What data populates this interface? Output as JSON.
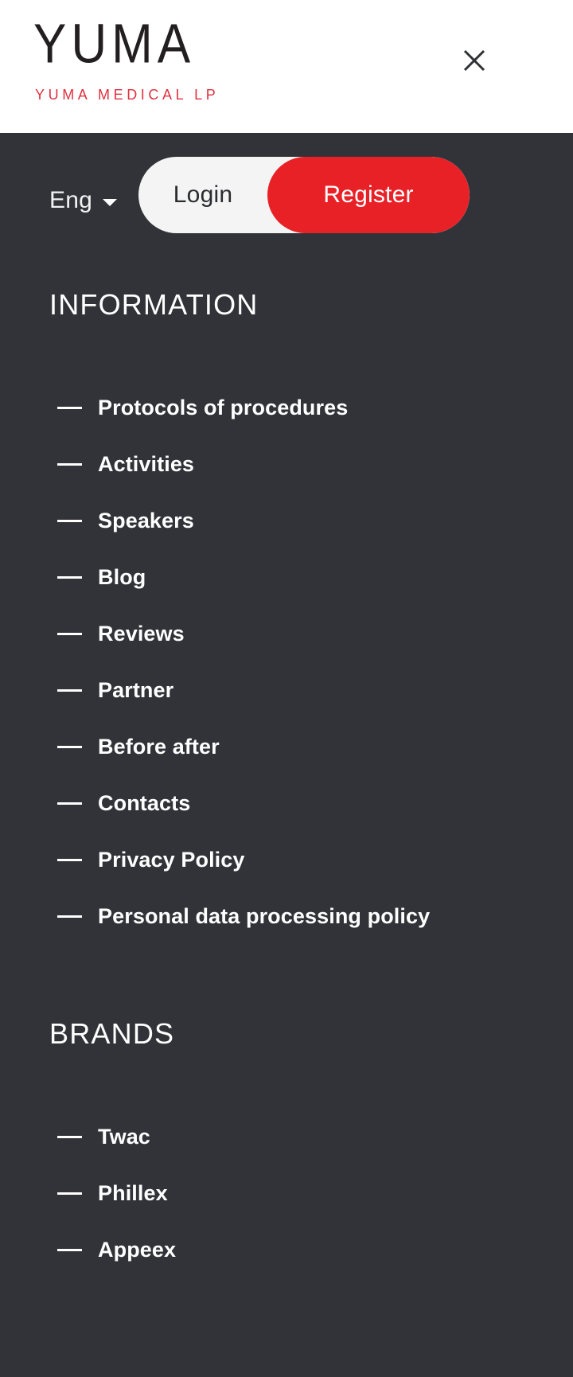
{
  "header": {
    "logo_word": "YUMA",
    "logo_subtitle": "YUMA MEDICAL LP",
    "close_icon": "close-icon",
    "brand_red": "#e0313f",
    "logo_black": "#231f20"
  },
  "panel": {
    "background": "#313338",
    "accent_red": "#e82127",
    "pill_background": "#f4f4f4"
  },
  "language": {
    "selected": "Eng",
    "caret_icon": "chevron-down-icon"
  },
  "auth": {
    "login_label": "Login",
    "register_label": "Register"
  },
  "nav": {
    "sections": [
      {
        "title": "INFORMATION",
        "items": [
          {
            "label": "Protocols of procedures"
          },
          {
            "label": "Activities"
          },
          {
            "label": "Speakers"
          },
          {
            "label": "Blog"
          },
          {
            "label": "Reviews"
          },
          {
            "label": "Partner"
          },
          {
            "label": "Before after"
          },
          {
            "label": "Contacts"
          },
          {
            "label": "Privacy Policy"
          },
          {
            "label": "Personal data processing policy"
          }
        ]
      },
      {
        "title": "BRANDS",
        "items": [
          {
            "label": "Twac"
          },
          {
            "label": "Phillex"
          },
          {
            "label": "Appeex"
          }
        ]
      }
    ]
  }
}
